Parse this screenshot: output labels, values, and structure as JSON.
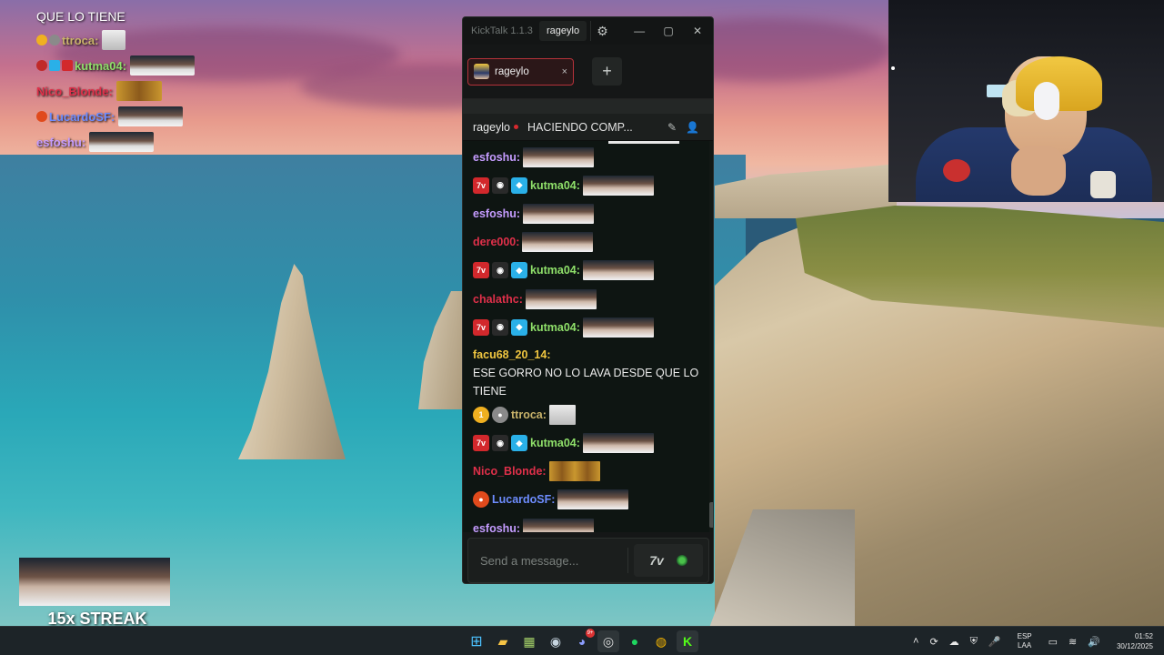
{
  "overlay_chat": {
    "top_text": "QUE LO TIENE",
    "lines": [
      {
        "user": "ttroca:",
        "color": "#c9b36a"
      },
      {
        "user": "kutma04:",
        "color": "#8fe06a"
      },
      {
        "user": "Nico_Blonde:",
        "color": "#e0304a"
      },
      {
        "user": "LucardoSF:",
        "color": "#6e8dff"
      },
      {
        "user": "esfoshu:",
        "color": "#c59cff"
      }
    ]
  },
  "streak": {
    "label": "15x STREAK"
  },
  "kicktalk": {
    "app_name": "KickTalk 1.1.3",
    "user_button": "rageylo",
    "tab": {
      "label": "rageylo",
      "close": "×"
    },
    "add_tab": "+",
    "header": {
      "channel": "rageylo",
      "stream_title": "HACIENDO COMP...",
      "live_color": "#d6292e"
    },
    "input_placeholder": "Send a message...",
    "seventv_label": "7v",
    "messages": [
      {
        "user": "esfoshu:",
        "color": "#c59cff",
        "badges": [],
        "emote": "face"
      },
      {
        "user": "kutma04:",
        "color": "#8fe06a",
        "badges": [
          "7tv",
          "mouth",
          "cube"
        ],
        "emote": "face"
      },
      {
        "user": "esfoshu:",
        "color": "#c59cff",
        "badges": [],
        "emote": "face"
      },
      {
        "user": "dere000:",
        "color": "#e0304a",
        "badges": [],
        "emote": "face"
      },
      {
        "user": "kutma04:",
        "color": "#8fe06a",
        "badges": [
          "7tv",
          "mouth",
          "cube"
        ],
        "emote": "face"
      },
      {
        "user": "chalathc:",
        "color": "#e0304a",
        "badges": [],
        "emote": "face"
      },
      {
        "user": "kutma04:",
        "color": "#8fe06a",
        "badges": [
          "7tv",
          "mouth",
          "cube"
        ],
        "emote": "face"
      },
      {
        "user": "facu68_20_14:",
        "color": "#f0c640",
        "badges": [],
        "text": "ESE GORRO NO LO LAVA DESDE QUE LO TIENE"
      },
      {
        "user": "ttroca:",
        "color": "#c9b36a",
        "badges": [
          "gold-1",
          "gray"
        ],
        "emote": "meme"
      },
      {
        "user": "kutma04:",
        "color": "#8fe06a",
        "badges": [
          "7tv",
          "mouth",
          "cube"
        ],
        "emote": "face"
      },
      {
        "user": "Nico_Blonde:",
        "color": "#e0304a",
        "badges": [],
        "emote": "trio"
      },
      {
        "user": "LucardoSF:",
        "color": "#6e8dff",
        "badges": [
          "red-ball"
        ],
        "emote": "face"
      },
      {
        "user": "esfoshu:",
        "color": "#c59cff",
        "badges": [],
        "emote": "face"
      }
    ]
  },
  "taskbar": {
    "lang_top": "ESP",
    "lang_bottom": "LAA",
    "time": "01:52",
    "date": "30/12/2025",
    "discord_badge": "9+"
  }
}
